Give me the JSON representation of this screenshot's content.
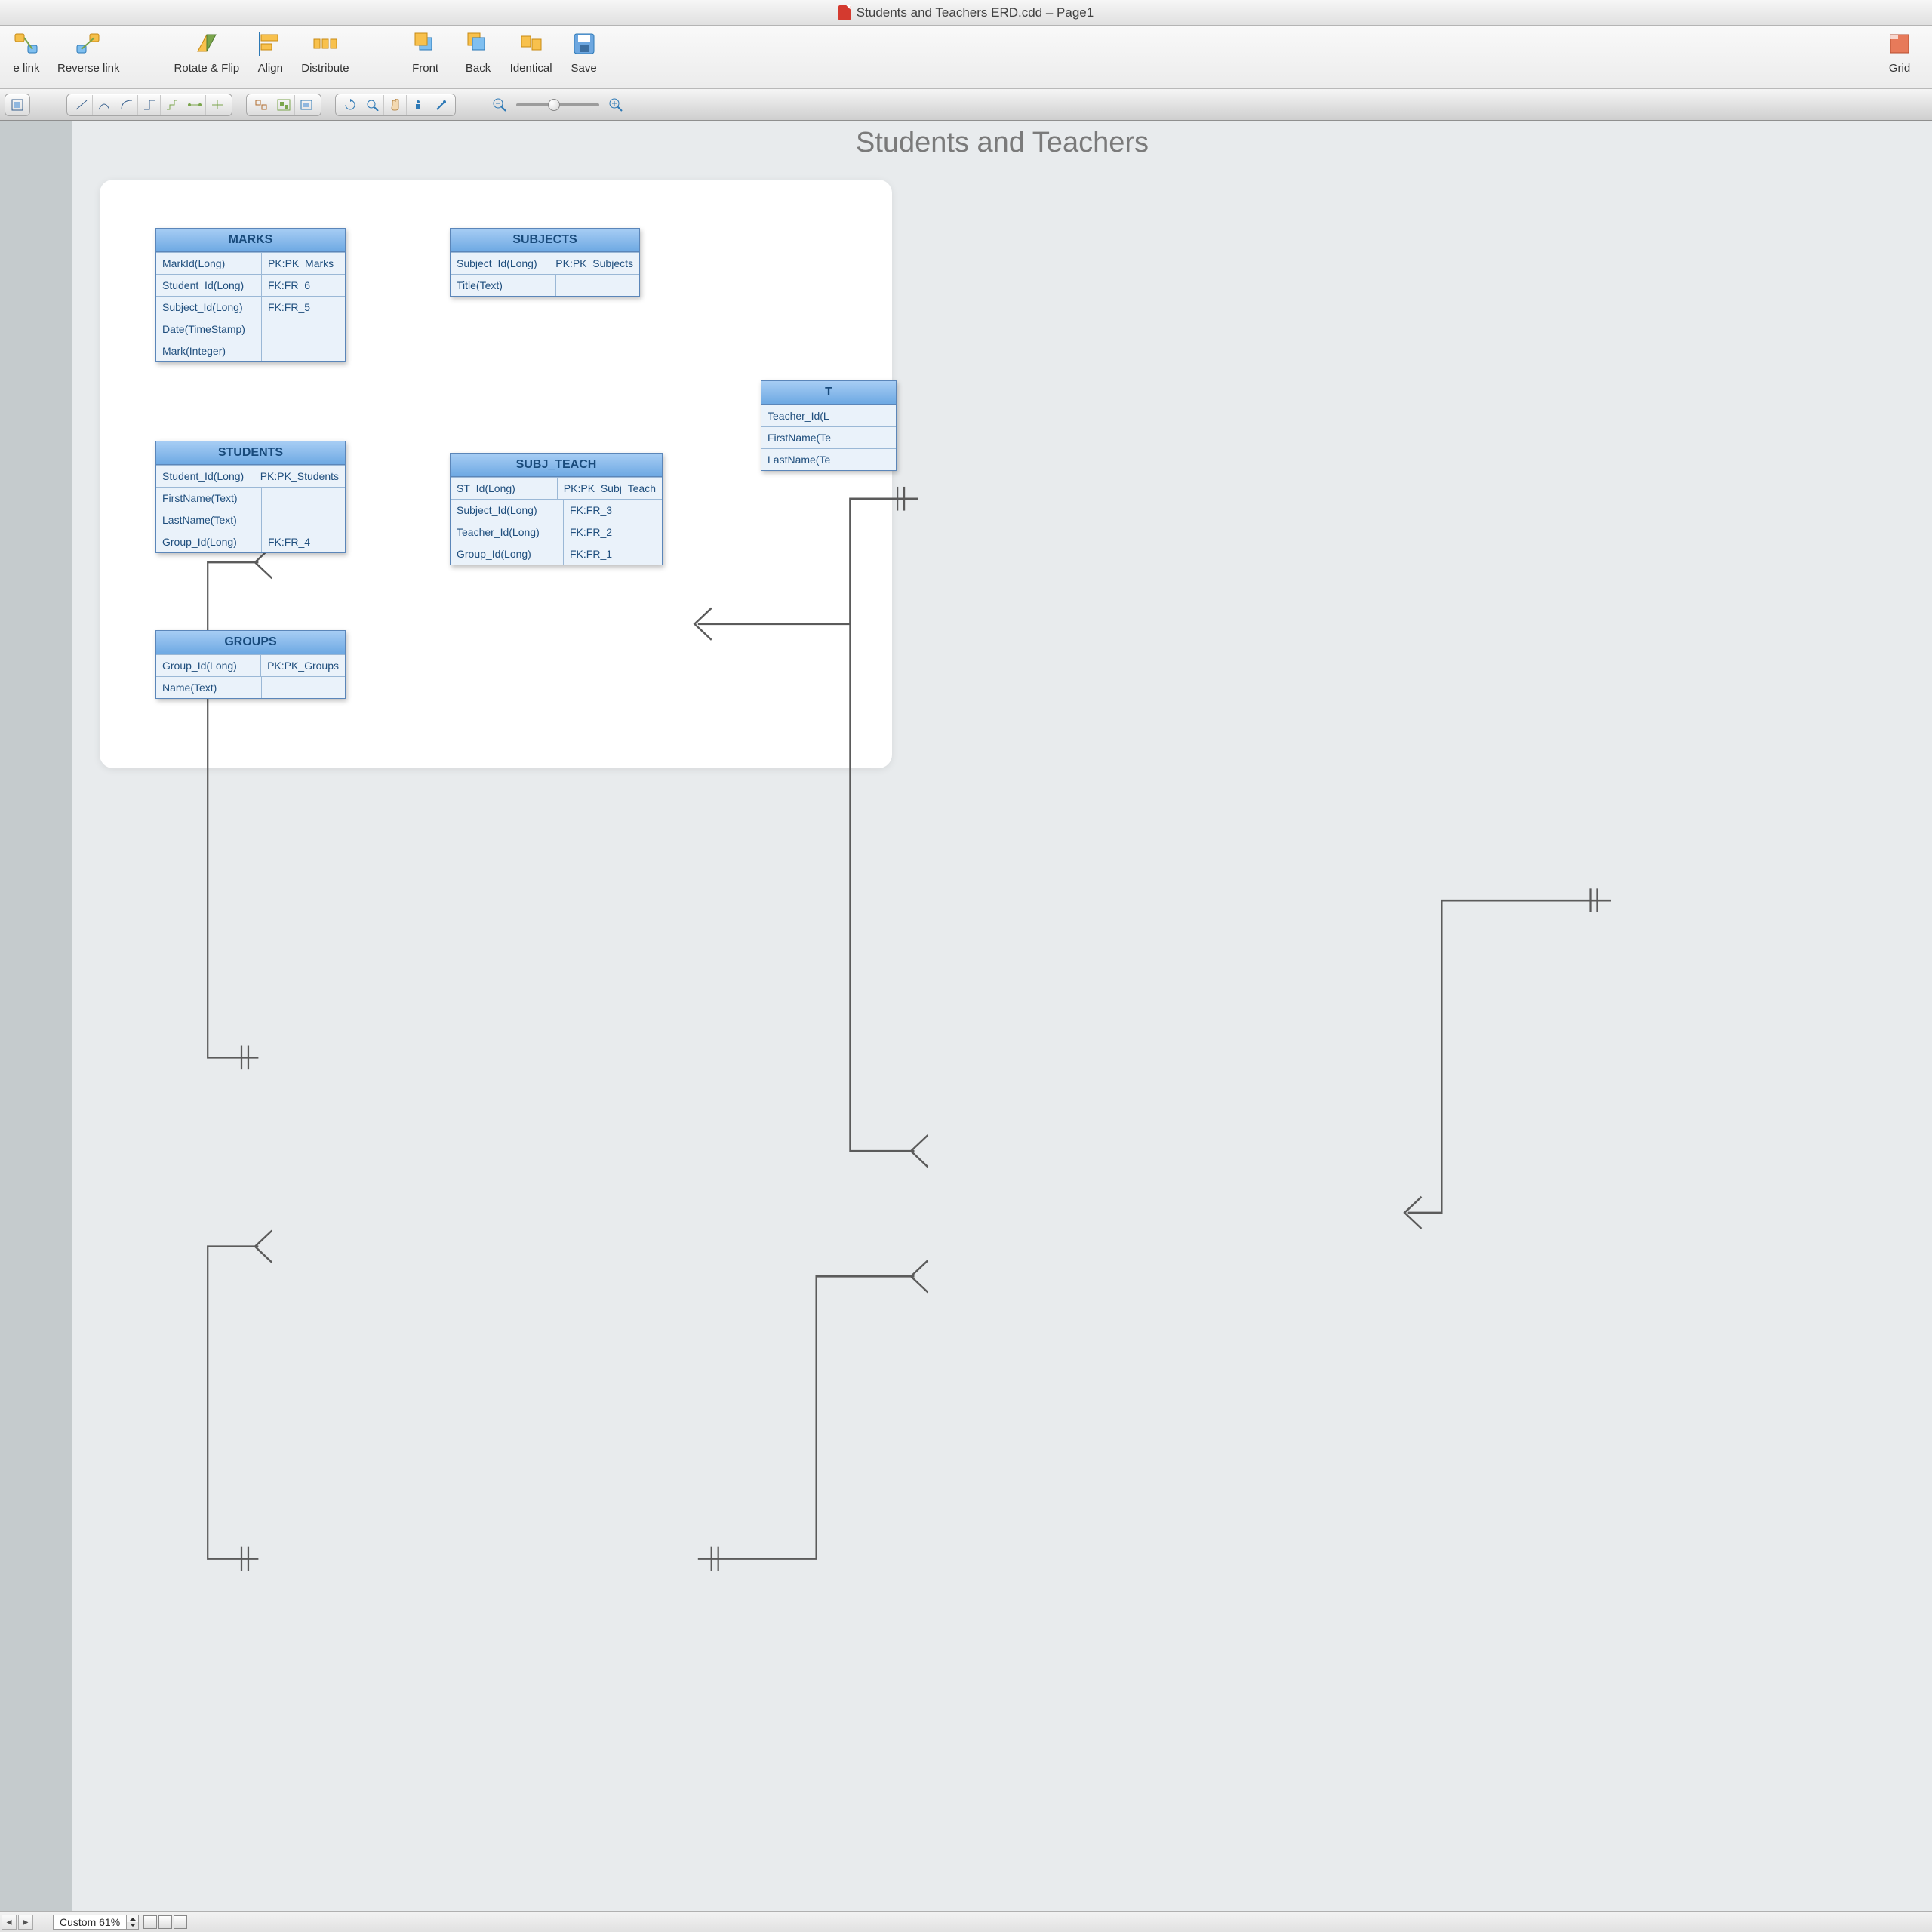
{
  "window": {
    "title": "Students and Teachers ERD.cdd – Page1"
  },
  "ribbon": {
    "btn_link": "e link",
    "reverse_link": "Reverse link",
    "rotate_flip": "Rotate & Flip",
    "align": "Align",
    "distribute": "Distribute",
    "front": "Front",
    "back": "Back",
    "identical": "Identical",
    "save": "Save",
    "grid": "Grid"
  },
  "status": {
    "zoom_label": "Custom 61%"
  },
  "diagram": {
    "title": "Students and Teachers",
    "entities": {
      "marks": {
        "name": "MARKS",
        "rows": [
          {
            "field": "MarkId(Long)",
            "key": "PK:PK_Marks"
          },
          {
            "field": "Student_Id(Long)",
            "key": "FK:FR_6"
          },
          {
            "field": "Subject_Id(Long)",
            "key": "FK:FR_5"
          },
          {
            "field": "Date(TimeStamp)",
            "key": ""
          },
          {
            "field": "Mark(Integer)",
            "key": ""
          }
        ]
      },
      "subjects": {
        "name": "SUBJECTS",
        "rows": [
          {
            "field": "Subject_Id(Long)",
            "key": "PK:PK_Subjects"
          },
          {
            "field": "Title(Text)",
            "key": ""
          }
        ]
      },
      "students": {
        "name": "STUDENTS",
        "rows": [
          {
            "field": "Student_Id(Long)",
            "key": "PK:PK_Students"
          },
          {
            "field": "FirstName(Text)",
            "key": ""
          },
          {
            "field": "LastName(Text)",
            "key": ""
          },
          {
            "field": "Group_Id(Long)",
            "key": "FK:FR_4"
          }
        ]
      },
      "subj_teach": {
        "name": "SUBJ_TEACH",
        "rows": [
          {
            "field": "ST_Id(Long)",
            "key": "PK:PK_Subj_Teach"
          },
          {
            "field": "Subject_Id(Long)",
            "key": "FK:FR_3"
          },
          {
            "field": "Teacher_Id(Long)",
            "key": "FK:FR_2"
          },
          {
            "field": "Group_Id(Long)",
            "key": "FK:FR_1"
          }
        ]
      },
      "groups": {
        "name": "GROUPS",
        "rows": [
          {
            "field": "Group_Id(Long)",
            "key": "PK:PK_Groups"
          },
          {
            "field": "Name(Text)",
            "key": ""
          }
        ]
      },
      "teachers": {
        "name": "T",
        "rows": [
          {
            "field": "Teacher_Id(L",
            "key": ""
          },
          {
            "field": "FirstName(Te",
            "key": ""
          },
          {
            "field": "LastName(Te",
            "key": ""
          }
        ]
      }
    }
  }
}
